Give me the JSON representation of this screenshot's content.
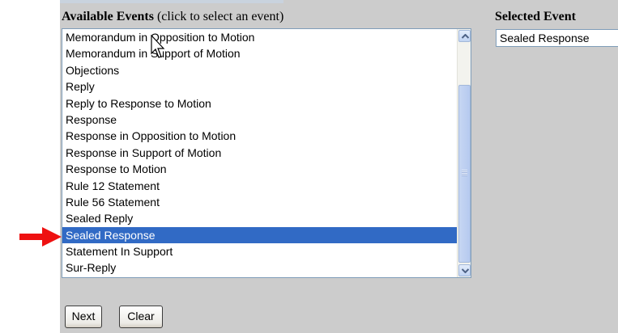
{
  "available_events": {
    "heading_bold": "Available Events",
    "heading_hint": "(click to select an event)",
    "selected_index": 12,
    "items": [
      "Memorandum in Opposition to Motion",
      "Memorandum in Support of Motion",
      "Objections",
      "Reply",
      "Reply to Response to Motion",
      "Response",
      "Response in Opposition to Motion",
      "Response in Support of Motion",
      "Response to Motion",
      "Rule 12 Statement",
      "Rule 56 Statement",
      "Sealed Reply",
      "Sealed Response",
      "Statement In Support",
      "Sur-Reply"
    ]
  },
  "selected_event": {
    "heading": "Selected Event",
    "value": "Sealed Response"
  },
  "buttons": {
    "next_label": "Next",
    "clear_label": "Clear"
  },
  "icons": {
    "scroll_up": "scroll-up-arrow-icon",
    "scroll_down": "scroll-down-arrow-icon",
    "annotation_arrow": "red-arrow-right-icon",
    "cursor": "mouse-pointer-icon"
  },
  "colors": {
    "panel_background": "#cccccc",
    "selection_highlight": "#316ac5",
    "annotation_arrow": "#ee1111"
  }
}
